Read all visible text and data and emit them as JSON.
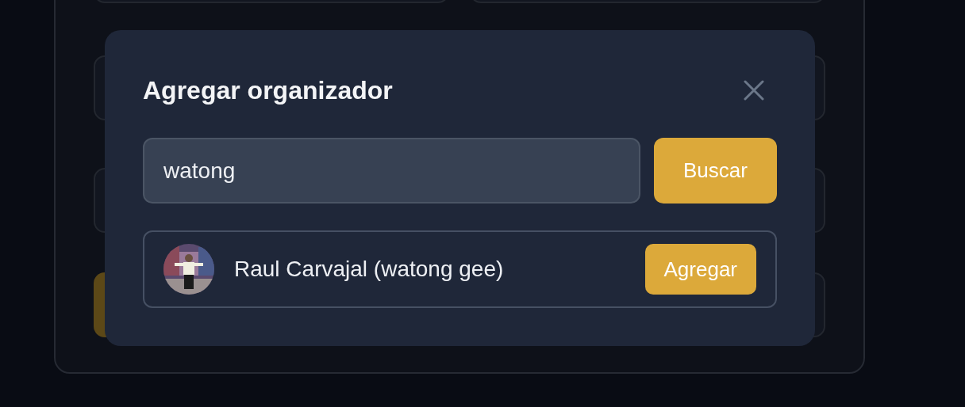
{
  "dialog": {
    "title": "Agregar organizador",
    "search": {
      "value": "watong",
      "button": "Buscar"
    },
    "results": [
      {
        "name": "Raul Carvajal (watong gee)",
        "button": "Agregar"
      }
    ]
  }
}
